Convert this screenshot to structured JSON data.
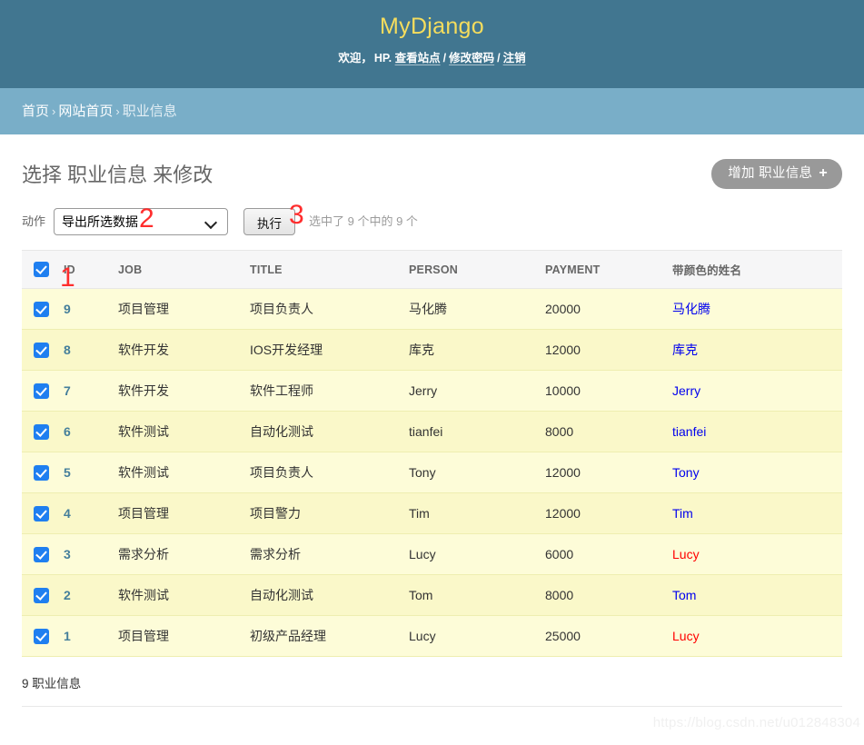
{
  "header": {
    "site_title": "MyDjango",
    "welcome_text": "欢迎，",
    "username": "HP.",
    "links": {
      "view_site": "查看站点",
      "change_password": "修改密码",
      "logout": "注销"
    },
    "separator": "/",
    "colors": {
      "header_bg": "#417690",
      "title": "#f5dd5d",
      "breadcrumb_bg": "#79aec8"
    }
  },
  "breadcrumbs": {
    "items": [
      {
        "label": "首页",
        "current": false
      },
      {
        "label": "网站首页",
        "current": false
      },
      {
        "label": "职业信息",
        "current": true
      }
    ],
    "separator": "›"
  },
  "page": {
    "title": "选择 职业信息 来修改",
    "add_button": {
      "label": "增加 职业信息",
      "icon": "plus-icon",
      "glyph": "+"
    }
  },
  "actions": {
    "label": "动作",
    "selected_option": "导出所选数据",
    "options": [
      "导出所选数据"
    ],
    "go_button": "执行",
    "counter": "选中了 9 个中的 9 个"
  },
  "table": {
    "select_all_checked": true,
    "headers": {
      "check": "",
      "id": "ID",
      "job": "JOB",
      "title": "TITLE",
      "person": "PERSON",
      "payment": "PAYMENT",
      "colored_name": "带颜色的姓名"
    },
    "rows": [
      {
        "checked": true,
        "id": "9",
        "job": "项目管理",
        "title": "项目负责人",
        "person": "马化腾",
        "payment": "20000",
        "colored_name": "马化腾",
        "color": "#0000ee"
      },
      {
        "checked": true,
        "id": "8",
        "job": "软件开发",
        "title": "IOS开发经理",
        "person": "库克",
        "payment": "12000",
        "colored_name": "库克",
        "color": "#0000ee"
      },
      {
        "checked": true,
        "id": "7",
        "job": "软件开发",
        "title": "软件工程师",
        "person": "Jerry",
        "payment": "10000",
        "colored_name": "Jerry",
        "color": "#0000ee"
      },
      {
        "checked": true,
        "id": "6",
        "job": "软件测试",
        "title": "自动化测试",
        "person": "tianfei",
        "payment": "8000",
        "colored_name": "tianfei",
        "color": "#0000ee"
      },
      {
        "checked": true,
        "id": "5",
        "job": "软件测试",
        "title": "项目负责人",
        "person": "Tony",
        "payment": "12000",
        "colored_name": "Tony",
        "color": "#0000ee"
      },
      {
        "checked": true,
        "id": "4",
        "job": "项目管理",
        "title": "项目警力",
        "person": "Tim",
        "payment": "12000",
        "colored_name": "Tim",
        "color": "#0000ee"
      },
      {
        "checked": true,
        "id": "3",
        "job": "需求分析",
        "title": "需求分析",
        "person": "Lucy",
        "payment": "6000",
        "colored_name": "Lucy",
        "color": "#ff0000"
      },
      {
        "checked": true,
        "id": "2",
        "job": "软件测试",
        "title": "自动化测试",
        "person": "Tom",
        "payment": "8000",
        "colored_name": "Tom",
        "color": "#0000ee"
      },
      {
        "checked": true,
        "id": "1",
        "job": "项目管理",
        "title": "初级产品经理",
        "person": "Lucy",
        "payment": "25000",
        "colored_name": "Lucy",
        "color": "#ff0000"
      }
    ]
  },
  "paginator": {
    "text": "9 职业信息"
  },
  "annotations": [
    {
      "id": "1",
      "label": "1"
    },
    {
      "id": "2",
      "label": "2"
    },
    {
      "id": "3",
      "label": "3"
    }
  ],
  "watermark": {
    "text": "https://blog.csdn.net/u012848304"
  }
}
